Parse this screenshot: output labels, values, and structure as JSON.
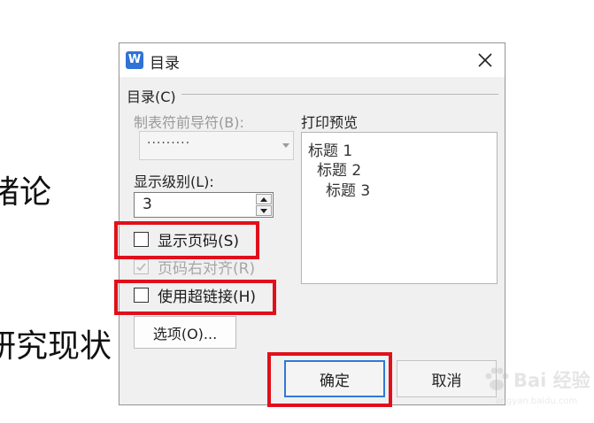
{
  "background_text": {
    "heading_fragment_1": "绪论",
    "heading_fragment_2": "研究现状"
  },
  "dialog": {
    "app_icon_letter": "W",
    "title": "目录",
    "group_label": "目录(C)",
    "leader_label": "制表符前导符(B):",
    "leader_value": "·········",
    "level_label": "显示级别(L):",
    "level_value": "3",
    "show_page_numbers_label": "显示页码(S)",
    "show_page_numbers_checked": false,
    "right_align_label": "页码右对齐(R)",
    "right_align_checked": true,
    "hyperlink_label": "使用超链接(H)",
    "hyperlink_checked": false,
    "options_button": "选项(O)...",
    "preview_label": "打印预览",
    "preview_lines": [
      "标题 1",
      "标题 2",
      "标题 3"
    ],
    "ok_button": "确定",
    "cancel_button": "取消"
  },
  "colors": {
    "highlight": "#e0101b",
    "accent": "#2e7bd6"
  },
  "watermark": {
    "text": "Bai 经验",
    "url": "jingyan.baidu.com"
  }
}
